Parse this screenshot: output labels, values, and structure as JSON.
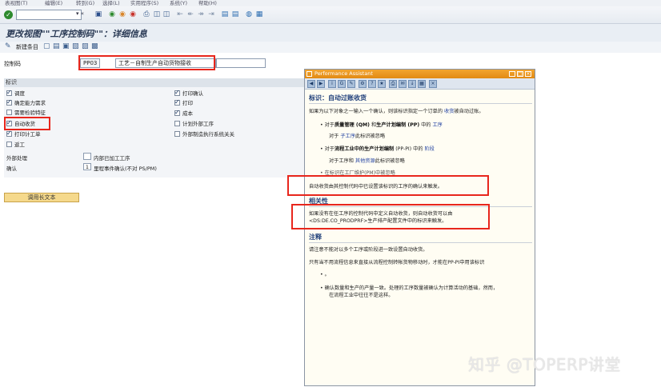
{
  "menu": [
    "表视图(T)",
    "编辑(E)",
    "转到(G)",
    "选择(L)",
    "实用程序(S)",
    "系统(Y)",
    "帮助(H)"
  ],
  "command_field": {
    "value": ""
  },
  "page_title": "更改视图\"\"工序控制码\"\"：详细信息",
  "toolbar2": {
    "new_entries": "新建条目"
  },
  "control_key": {
    "label": "控制码",
    "code": "PP03",
    "description": "工艺－自制生产自动货物接收"
  },
  "group": {
    "header": "标识",
    "left_items": [
      {
        "label": "调度",
        "checked": true
      },
      {
        "label": "确定能力需求",
        "checked": true
      },
      {
        "label": "需要检验特征",
        "checked": false
      },
      {
        "label": "自动收货",
        "checked": true
      },
      {
        "label": "打印计工单",
        "checked": true
      },
      {
        "label": "返工",
        "checked": false
      }
    ],
    "right_items": [
      {
        "label": "打印确认",
        "checked": true
      },
      {
        "label": "打印",
        "checked": true
      },
      {
        "label": "成本",
        "checked": true
      },
      {
        "label": "计划外部工序",
        "checked": false
      },
      {
        "label": "外部制造执行系统关关",
        "checked": false
      }
    ],
    "external_label": "外部处理",
    "external_value": "",
    "external_text": "内部已加工工序",
    "confirm_label": "确认",
    "confirm_value": "1",
    "confirm_text": "里程事件确认(不对 PS/PM)"
  },
  "long_text_button": "调用长文本",
  "assistant": {
    "window_title": "Performance Assistant",
    "heading1": "标识：自动过账收货",
    "intro_pre": "如果为以下对象之一输入一个确认，则该标识指定一个订单的",
    "intro_link": "收货",
    "intro_post": "被自动过账。",
    "b1_pre": "对于",
    "b1_bold": "质量管理 (QM)",
    "b1_mid": " 和",
    "b1_bold2": "生产计划编制 (PP)",
    "b1_post": " 中的 ",
    "b1_link": "工序",
    "b1_sub_pre": "对于 ",
    "b1_sub_link": "子工序",
    "b1_sub_post": "此标识被忽略",
    "b2_pre": "对于",
    "b2_bold": "流程工业中的生产计划编制",
    "b2_mid": " (PP-PI) 中的 ",
    "b2_link": "阶段",
    "b2_sub_pre": "对于工序和 ",
    "b2_sub_link": "其他资源",
    "b2_sub_post": "此标识被忽略",
    "b3_text": "在标识在工厂维护(PM)中被忽略",
    "note1": "自动收货由其控制代码中已设置该标识的工序的确认来触发。",
    "heading2": "相关性",
    "dep_line1": "如果没有在任工序的控制代码中定义自动收货，则自动收货可以由",
    "dep_line2": "<DS:DE.CO_PRODPRF>生产排产配置文件中的标识来触发。",
    "heading3": "注释",
    "note_line1": "请注意不能对以多个工序或阶段进一致设置自动收货。",
    "note_line2": "只有当不用流程信息来直接从流程控制转帐货物移动时，才能在PP-PI中用该标识",
    "bullet_dot": "。",
    "final_line1": "确认数量和生产的产量一致。处理的工序数量被确认为计算活动的基础，然而，",
    "final_line2": "在流程工业中往往不是这样。"
  },
  "watermark": {
    "prefix": "知乎 @",
    "brand": "TOPERP讲堂"
  },
  "icons": {
    "ok": "ok-checkmark-icon",
    "save": "save-icon",
    "back": "back-icon",
    "exit": "exit-icon",
    "cancel": "cancel-icon",
    "print": "print-icon",
    "find": "find-icon",
    "help": "help-icon"
  },
  "colors": {
    "highlight_border": "#e8261c",
    "assistant_title": "#e28a13",
    "heading": "#1f3f7a"
  }
}
